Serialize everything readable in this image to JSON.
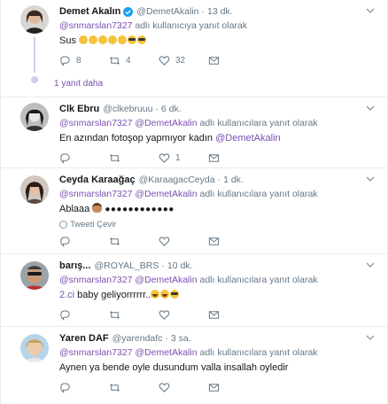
{
  "colors": {
    "accent": "#7b4fb1",
    "muted": "#657786",
    "text": "#14171a",
    "border": "#e6ecf0",
    "verified": "#1da1f2"
  },
  "tweets": [
    {
      "name": "Demet Akalın",
      "handle": "@DemetAkalin",
      "time": "13 dk.",
      "verified": true,
      "reply_mentions": "@snmarslan7327",
      "reply_suffix": " adlı kullanıcıya yanıt olarak",
      "text": "Sus",
      "emojis": [
        "sad",
        "sad",
        "sad",
        "sad",
        "sad",
        "glasses",
        "glasses"
      ],
      "reply_count": "8",
      "retweet_count": "4",
      "like_count": "32",
      "more_replies": "1 yanıt daha"
    },
    {
      "name": "Clk Ebru",
      "handle": "@clkebruuu",
      "time": "6 dk.",
      "reply_mentions": "@snmarslan7327 @DemetAkalin",
      "reply_suffix": " adlı kullanıcılara yanıt olarak",
      "text_prefix": "En azından fotoşop yapmıyor kadın ",
      "text_mention": "@DemetAkalin",
      "reply_count": "",
      "retweet_count": "",
      "like_count": "1"
    },
    {
      "name": "Ceyda Karaağaç",
      "handle": "@KaraagacCeyda",
      "time": "1 dk.",
      "reply_mentions": "@snmarslan7327 @DemetAkalin",
      "reply_suffix": " adlı kullanıcılara yanıt olarak",
      "text": "Ablaaa",
      "dots": "●●●●●●●●●●●●",
      "translate": "Tweeti Çevir"
    },
    {
      "name": "barış...",
      "handle": "@ROYAL_BRS",
      "time": "10 dk.",
      "reply_mentions": "@snmarslan7327 @DemetAkalin",
      "reply_suffix": " adlı kullanıcılara yanıt olarak",
      "text_mention": "2.ci",
      "text_rest": " baby geliyorrrrrr..",
      "emojis": [
        "laugh",
        "laugh",
        "glasses"
      ]
    },
    {
      "name": "Yaren DAF",
      "handle": "@yarendafc",
      "time": "3 sa.",
      "reply_mentions": "@snmarslan7327 @DemetAkalin",
      "reply_suffix": " adlı kullanıcılara yanıt olarak",
      "text": "Aynen ya bende oyle dusundum valla insallah oyledir"
    }
  ]
}
